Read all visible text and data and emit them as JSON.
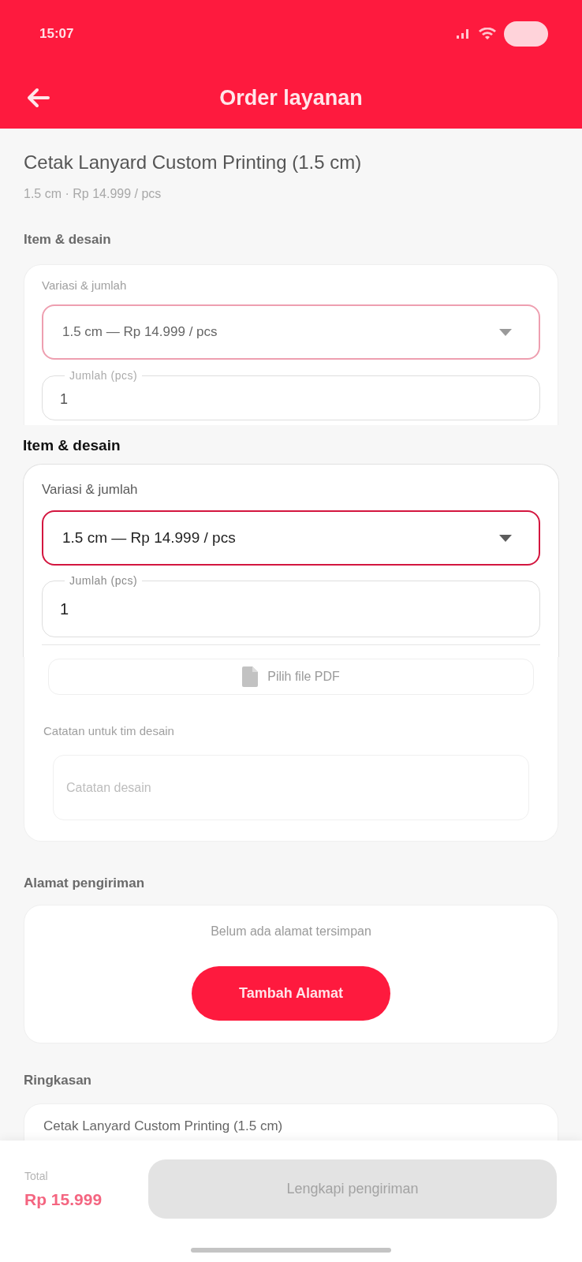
{
  "status_bar": {
    "time": "15:07"
  },
  "header": {
    "title": "Order layanan"
  },
  "product": {
    "title": "Cetak Lanyard Custom Printing (1.5 cm)",
    "subtitle": "1.5 cm · Rp 14.999 / pcs"
  },
  "item_section": {
    "heading": "Item & desain",
    "variation_label": "Variasi & jumlah",
    "variation_select": {
      "value": "1.5 cm — Rp 14.999 / pcs",
      "focused": true
    },
    "quantity": {
      "label": "Jumlah (pcs)",
      "value": "1"
    },
    "file_button": "Pilih file PDF",
    "notes_label": "Catatan untuk tim desain",
    "notes_field": {
      "placeholder": "Catatan desain"
    }
  },
  "zoom_panel": {
    "heading": "Item & desain",
    "variation_label": "Variasi & jumlah",
    "variation_select": {
      "value": "1.5 cm — Rp 14.999 / pcs",
      "focused": true
    },
    "quantity": {
      "label": "Jumlah (pcs)",
      "value": "1"
    }
  },
  "address_section": {
    "heading": "Alamat pengiriman",
    "empty_text": "Belum ada alamat tersimpan",
    "add_button": "Tambah Alamat"
  },
  "summary_section": {
    "heading": "Ringkasan",
    "item": "Cetak Lanyard Custom Printing (1.5 cm)"
  },
  "footer": {
    "total_label": "Total",
    "total_value": "Rp 15.999",
    "submit_button": {
      "label": "Lengkapi pengiriman",
      "disabled": true
    }
  }
}
